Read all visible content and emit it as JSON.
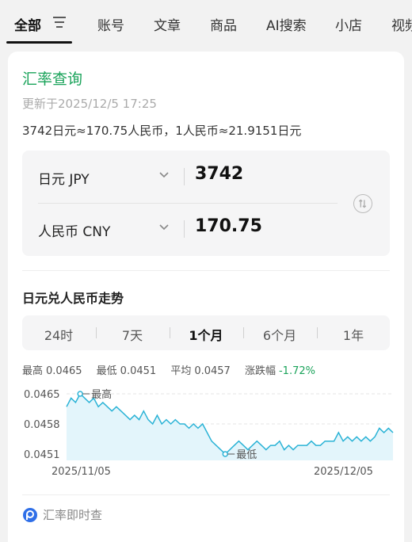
{
  "tabs": [
    {
      "label": "全部"
    },
    {
      "label": "账号"
    },
    {
      "label": "文章"
    },
    {
      "label": "商品"
    },
    {
      "label": "AI搜索"
    },
    {
      "label": "小店"
    },
    {
      "label": "视频"
    }
  ],
  "card": {
    "title": "汇率查询",
    "updated": "更新于2025/12/5 17:25",
    "summary": "3742日元≈170.75人民币，1人民币≈21.9151日元"
  },
  "converter": {
    "from": {
      "currency": "日元 JPY",
      "amount": "3742"
    },
    "to": {
      "currency": "人民币 CNY",
      "amount": "170.75"
    }
  },
  "trend": {
    "title": "日元兑人民币走势",
    "periods": [
      "24时",
      "7天",
      "1个月",
      "6个月",
      "1年"
    ],
    "active_period": "1个月",
    "stats": {
      "high_label": "最高",
      "high": "0.0465",
      "low_label": "最低",
      "low": "0.0451",
      "avg_label": "平均",
      "avg": "0.0457",
      "change_label": "涨跌幅",
      "change": "-1.72%"
    }
  },
  "chart_data": {
    "type": "line",
    "x_start": "2025/11/05",
    "x_end": "2025/12/05",
    "yticks": [
      "0.0465",
      "0.0458",
      "0.0451"
    ],
    "ylim": [
      0.0451,
      0.0465
    ],
    "annotations": {
      "high": "最高",
      "low": "最低"
    },
    "values": [
      0.0462,
      0.0464,
      0.0463,
      0.0465,
      0.0464,
      0.0463,
      0.0464,
      0.0462,
      0.0463,
      0.0462,
      0.0461,
      0.0462,
      0.0461,
      0.046,
      0.0459,
      0.046,
      0.0459,
      0.0461,
      0.0459,
      0.0458,
      0.046,
      0.0458,
      0.0459,
      0.0458,
      0.0459,
      0.0458,
      0.0458,
      0.0457,
      0.0458,
      0.0457,
      0.0458,
      0.0456,
      0.0454,
      0.0453,
      0.0452,
      0.0451,
      0.0452,
      0.0453,
      0.0454,
      0.0453,
      0.0452,
      0.0453,
      0.0454,
      0.0453,
      0.0452,
      0.0453,
      0.0453,
      0.0454,
      0.0452,
      0.0453,
      0.0452,
      0.0453,
      0.0453,
      0.0453,
      0.0454,
      0.0453,
      0.0453,
      0.0454,
      0.0454,
      0.0454,
      0.0456,
      0.0454,
      0.0455,
      0.0454,
      0.0455,
      0.0454,
      0.0455,
      0.0454,
      0.0455,
      0.0457,
      0.0456,
      0.0457,
      0.0456
    ],
    "line_color": "#2bb3d6",
    "area_color": "#e3f5fb",
    "grid": true
  },
  "footer": {
    "label": "汇率即时查",
    "icon": "ptitle-icon"
  },
  "colors": {
    "accent": "#1aa35a",
    "negative": "#1aa35a"
  }
}
